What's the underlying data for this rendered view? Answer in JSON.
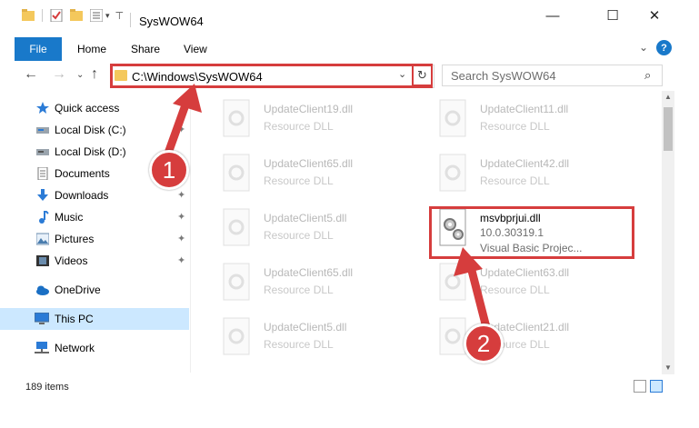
{
  "window": {
    "title": "SysWOW64",
    "minimize_glyph": "—",
    "maximize_glyph": "☐",
    "close_glyph": "✕"
  },
  "ribbon": {
    "tabs": [
      "File",
      "Home",
      "Share",
      "View"
    ],
    "expand_glyph": "⌄",
    "help_glyph": "?"
  },
  "nav": {
    "back_glyph": "←",
    "forward_glyph": "→",
    "recent_glyph": "⌄",
    "up_glyph": "↑",
    "address": "C:\\Windows\\SysWOW64",
    "address_chevron": "⌄",
    "refresh_glyph": "↻",
    "search_placeholder": "Search SysWOW64",
    "search_glyph": "⌕"
  },
  "sidebar": {
    "items": [
      {
        "label": "Quick access",
        "icon": "star-icon",
        "pinned": false
      },
      {
        "label": "Local Disk (C:)",
        "icon": "drive-icon",
        "pinned": true
      },
      {
        "label": "Local Disk (D:)",
        "icon": "drive-icon",
        "pinned": true
      },
      {
        "label": "Documents",
        "icon": "documents-icon",
        "pinned": true
      },
      {
        "label": "Downloads",
        "icon": "downloads-icon",
        "pinned": true
      },
      {
        "label": "Music",
        "icon": "music-icon",
        "pinned": true
      },
      {
        "label": "Pictures",
        "icon": "pictures-icon",
        "pinned": true
      },
      {
        "label": "Videos",
        "icon": "videos-icon",
        "pinned": true
      },
      {
        "label": "OneDrive",
        "icon": "onedrive-icon",
        "pinned": false
      },
      {
        "label": "This PC",
        "icon": "this-pc-icon",
        "pinned": false,
        "selected": true
      },
      {
        "label": "Network",
        "icon": "network-icon",
        "pinned": false
      }
    ],
    "pin_glyph": "📌"
  },
  "files": {
    "left": [
      {
        "name": "UpdateClient19.dll",
        "type": "Resource DLL"
      },
      {
        "name": "UpdateClient65.dll",
        "type": "Resource DLL"
      },
      {
        "name": "UpdateClient5.dll",
        "type": "Resource DLL"
      },
      {
        "name": "UpdateClient65.dll",
        "type": "Resource DLL"
      },
      {
        "name": "UpdateClient5.dll",
        "type": "Resource DLL"
      }
    ],
    "right": [
      {
        "name": "UpdateClient11.dll",
        "type": "Resource DLL"
      },
      {
        "name": "UpdateClient42.dll",
        "type": "Resource DLL"
      },
      {
        "name": "msvbprjui.dll",
        "version": "10.0.30319.1",
        "type": "Visual Basic Projec...",
        "active": true
      },
      {
        "name": "UpdateClient63.dll",
        "type": "Resource DLL"
      },
      {
        "name": "UpdateClient21.dll",
        "type": "Resource DLL"
      }
    ]
  },
  "status": {
    "count": "189 items"
  },
  "annotations": {
    "badge1": "1",
    "badge2": "2",
    "accent": "#d63d3d"
  }
}
